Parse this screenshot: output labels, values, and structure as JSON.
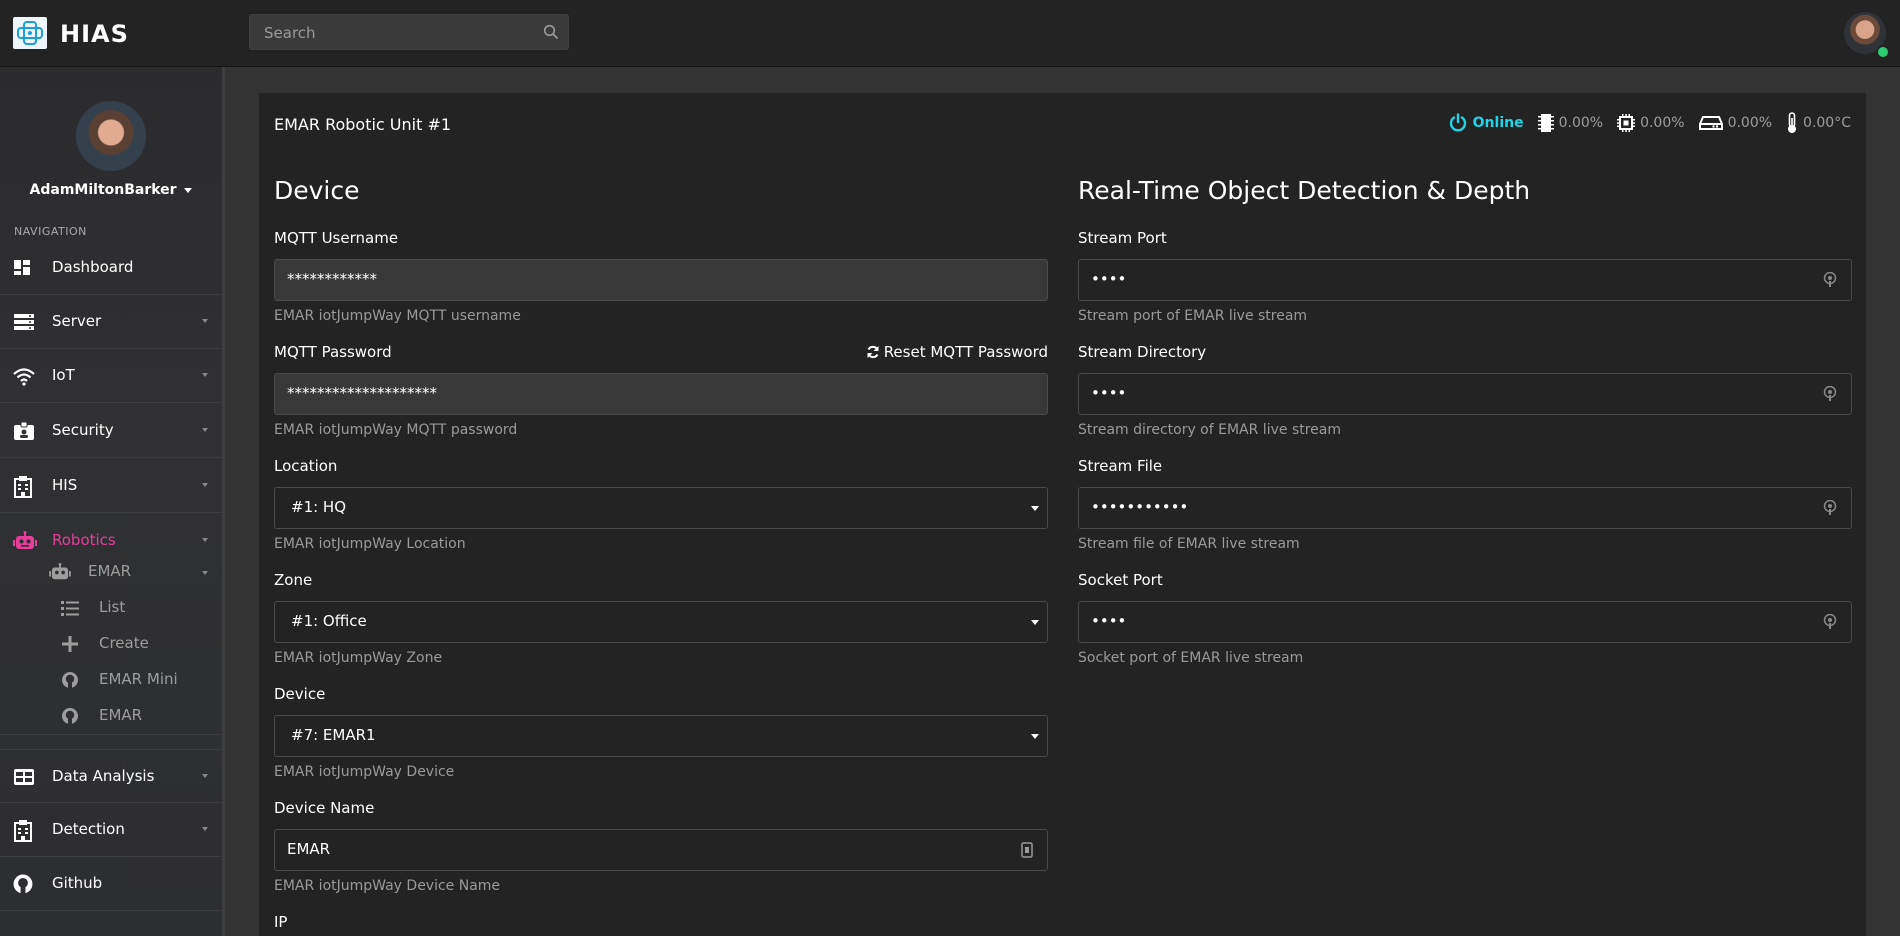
{
  "app": {
    "brand": "HIAS"
  },
  "search": {
    "placeholder": "Search"
  },
  "profile": {
    "name": "AdamMiltonBarker"
  },
  "nav": {
    "heading": "NAVIGATION",
    "items": [
      {
        "label": "Dashboard",
        "icon": "dashboard-icon"
      },
      {
        "label": "Server",
        "icon": "server-icon"
      },
      {
        "label": "IoT",
        "icon": "wifi-icon"
      },
      {
        "label": "Security",
        "icon": "id-badge-icon"
      },
      {
        "label": "HIS",
        "icon": "hospital-icon"
      },
      {
        "label": "Robotics",
        "icon": "robot-icon"
      },
      {
        "label": "Data Analysis",
        "icon": "table-icon"
      },
      {
        "label": "Detection",
        "icon": "hospital-icon"
      },
      {
        "label": "Github",
        "icon": "github-icon"
      }
    ],
    "robotics_sub": {
      "parent": "EMAR",
      "children": [
        "List",
        "Create",
        "EMAR Mini",
        "EMAR"
      ]
    }
  },
  "page": {
    "title": "EMAR Robotic Unit #1",
    "stats": {
      "status": "Online",
      "cpu": "0.00%",
      "memory": "0.00%",
      "disk": "0.00%",
      "temperature": "0.00°C"
    }
  },
  "device_section": {
    "heading": "Device",
    "mqtt_username": {
      "label": "MQTT Username",
      "value": "************",
      "help": "EMAR iotJumpWay MQTT username"
    },
    "mqtt_password": {
      "label": "MQTT Password",
      "value": "********************",
      "help": "EMAR iotJumpWay MQTT password",
      "reset_label": "Reset MQTT Password"
    },
    "location": {
      "label": "Location",
      "value": "#1: HQ",
      "help": "EMAR iotJumpWay Location"
    },
    "zone": {
      "label": "Zone",
      "value": "#1: Office",
      "help": "EMAR iotJumpWay Zone"
    },
    "device": {
      "label": "Device",
      "value": "#7: EMAR1",
      "help": "EMAR iotJumpWay Device"
    },
    "device_name": {
      "label": "Device Name",
      "value": "EMAR",
      "help": "EMAR iotJumpWay Device Name"
    },
    "ip": {
      "label": "IP"
    }
  },
  "stream_section": {
    "heading": "Real-Time Object Detection & Depth",
    "stream_port": {
      "label": "Stream Port",
      "value": "••••",
      "help": "Stream port of EMAR live stream"
    },
    "stream_directory": {
      "label": "Stream Directory",
      "value": "••••",
      "help": "Stream directory of EMAR live stream"
    },
    "stream_file": {
      "label": "Stream File",
      "value": "•••••••••••",
      "help": "Stream file of EMAR live stream"
    },
    "socket_port": {
      "label": "Socket Port",
      "value": "••••",
      "help": "Socket port of EMAR live stream"
    }
  },
  "colors": {
    "accent_online": "#21d3e6",
    "active_nav": "#e63e9b",
    "background": "#232323"
  }
}
